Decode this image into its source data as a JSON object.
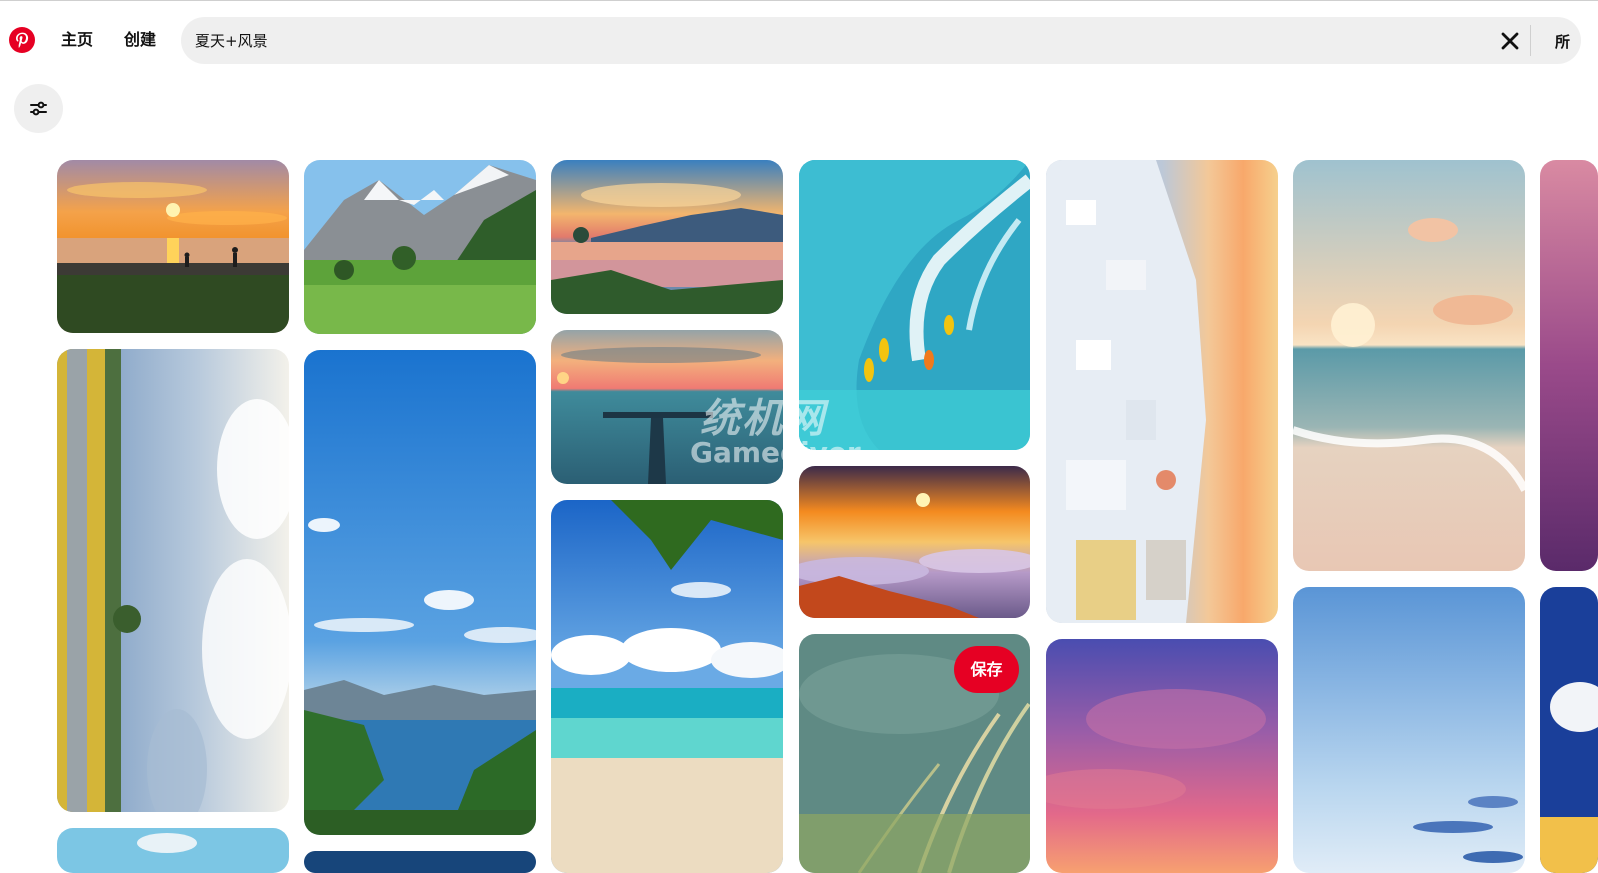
{
  "nav": {
    "home_label": "主页",
    "create_label": "创建"
  },
  "search": {
    "value": "夏天+风景",
    "scope_label": "所"
  },
  "pins": {
    "save_label": "保存"
  },
  "watermark": {
    "cn": "统机网",
    "en": "Gamediver"
  },
  "icons": {
    "logo": "pinterest-logo",
    "clear": "close-icon",
    "filter": "filter-icon"
  },
  "colors": {
    "brand": "#e60023",
    "search_bg": "#efefef"
  }
}
